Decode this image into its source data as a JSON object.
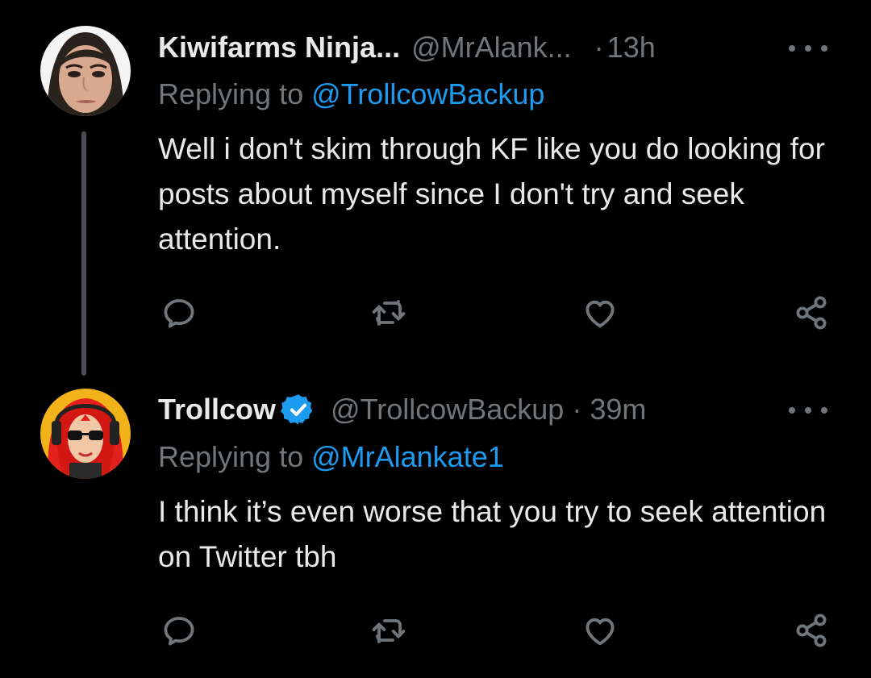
{
  "tweets": [
    {
      "display_name": "Kiwifarms Ninja...",
      "handle": "@MrAlank...",
      "dot": "·",
      "time": "13h",
      "replying_prefix": "Replying to ",
      "replying_to": "@TrollcowBackup",
      "text": "Well i don't skim through KF like you do looking for posts about myself since I don't try and seek attention.",
      "verified": false,
      "avatar_icon": "user-avatar-photo"
    },
    {
      "display_name": "Trollcow",
      "handle": "@TrollcowBackup",
      "dot": "·",
      "time": "39m",
      "replying_prefix": "Replying to ",
      "replying_to": "@MrAlankate1",
      "text": "I think it’s even worse that you try to seek attention on Twitter tbh",
      "verified": true,
      "avatar_icon": "user-avatar-illustration"
    }
  ],
  "action_icons": [
    "reply-icon",
    "retweet-icon",
    "like-icon",
    "share-icon"
  ],
  "colors": {
    "background": "#000000",
    "primary_text": "#e7e9ea",
    "secondary_text": "#71767b",
    "link": "#1d9bf0",
    "thread_line": "#4a4d52"
  }
}
